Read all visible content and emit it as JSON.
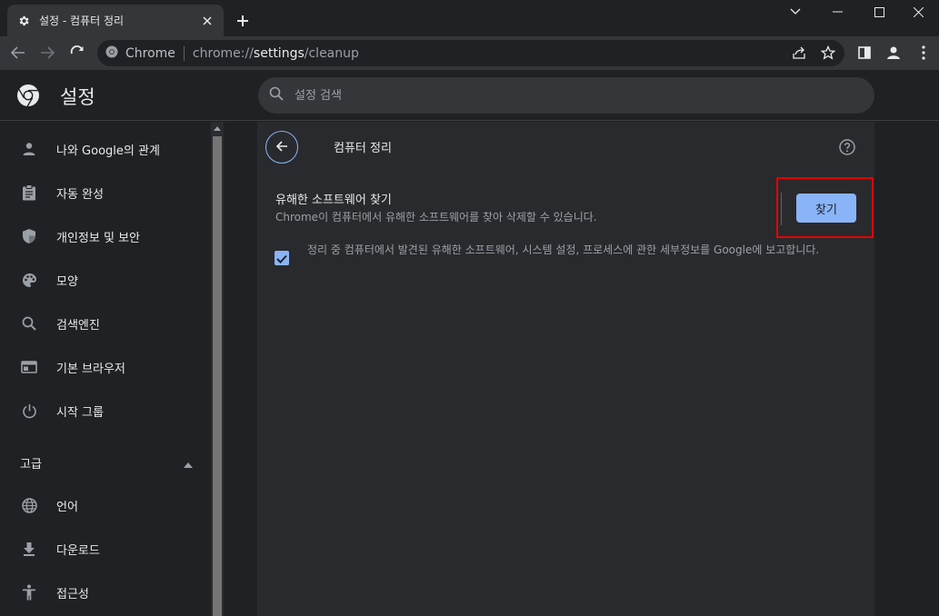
{
  "window": {
    "tab_title": "설정 - 컴퓨터 정리"
  },
  "toolbar": {
    "site_label": "Chrome",
    "url_scheme": "chrome://",
    "url_host": "settings",
    "url_path": "/cleanup"
  },
  "header": {
    "title": "설정",
    "search_placeholder": "설정 검색"
  },
  "sidebar": {
    "items": [
      {
        "label": "나와 Google의 관계",
        "icon": "person-icon"
      },
      {
        "label": "자동 완성",
        "icon": "clipboard-icon"
      },
      {
        "label": "개인정보 및 보안",
        "icon": "shield-icon"
      },
      {
        "label": "모양",
        "icon": "palette-icon"
      },
      {
        "label": "검색엔진",
        "icon": "search-icon"
      },
      {
        "label": "기본 브라우저",
        "icon": "browser-icon"
      },
      {
        "label": "시작 그룹",
        "icon": "power-icon"
      }
    ],
    "advanced_label": "고급",
    "advanced_items": [
      {
        "label": "언어",
        "icon": "globe-icon"
      },
      {
        "label": "다운로드",
        "icon": "download-icon"
      },
      {
        "label": "접근성",
        "icon": "accessibility-icon"
      }
    ]
  },
  "main": {
    "page_title": "컴퓨터 정리",
    "find_title": "유해한 소프트웨어 찾기",
    "find_subtitle": "Chrome이 컴퓨터에서 유해한 소프트웨어를 찾아 삭제할 수 있습니다.",
    "find_button": "찾기",
    "report_checkbox_checked": true,
    "report_text": "정리 중 컴퓨터에서 발견된 유해한 소프트웨어, 시스템 설정, 프로세스에 관한 세부정보를 Google에 보고합니다."
  },
  "colors": {
    "accent": "#8ab4f8",
    "highlight": "#e60000",
    "background": "#202124",
    "card": "#292a2d"
  }
}
